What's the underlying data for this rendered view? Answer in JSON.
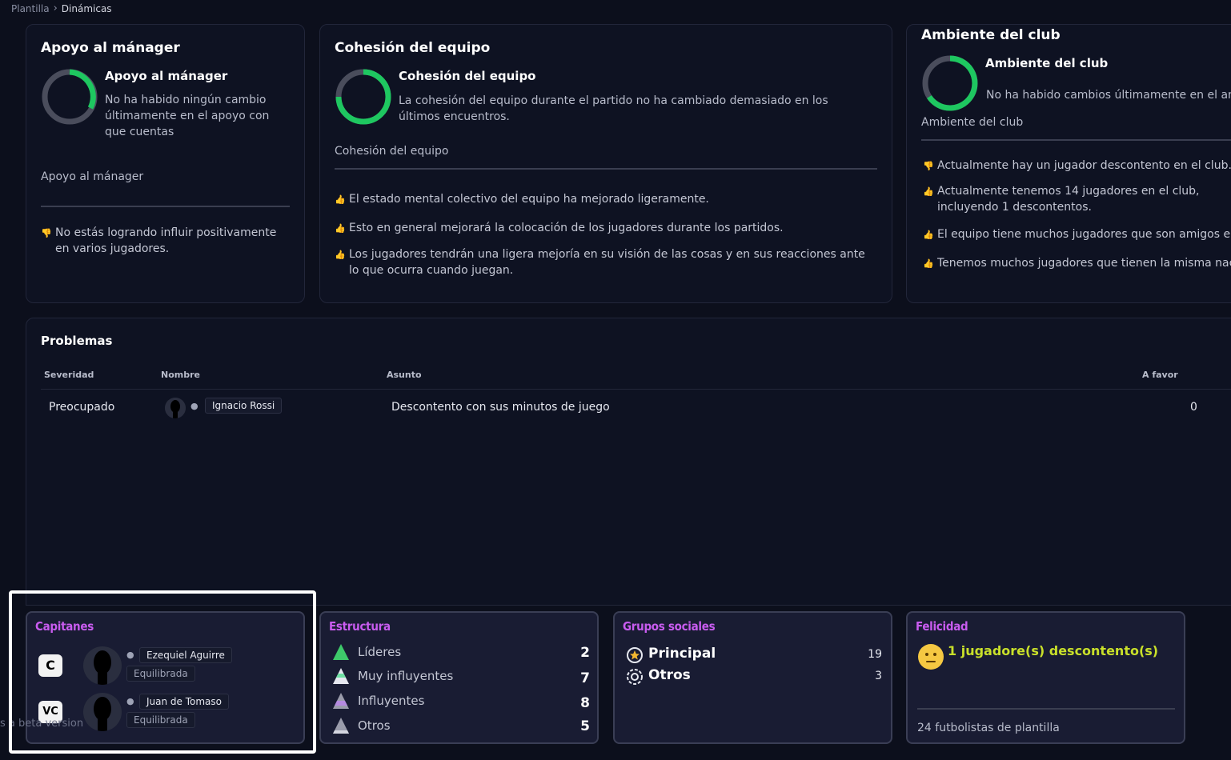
{
  "breadcrumb": {
    "parent": "Plantilla",
    "separator": ">",
    "current": "Dinámicas"
  },
  "manager_card": {
    "title": "Apoyo al mánager",
    "subtitle": "Apoyo al mánager",
    "description": "No ha habido ningún cambio últimamente en el apoyo con que cuentas",
    "caption": "Apoyo al mánager",
    "facts": [
      {
        "text": "No estás logrando influir positivamente en varios jugadores.",
        "icon": "thumbs-down-icon"
      }
    ]
  },
  "cohesion_card": {
    "title": "Cohesión del equipo",
    "subtitle": "Cohesión del equipo",
    "description": "La cohesión del equipo durante el partido no ha cambiado demasiado en los últimos encuentros.",
    "caption": "Cohesión del equipo",
    "facts": [
      {
        "text": "El estado mental colectivo del equipo ha mejorado ligeramente.",
        "icon": "thumbs-up-icon"
      },
      {
        "text": "Esto en general mejorará la colocación de los jugadores durante los partidos.",
        "icon": "thumbs-up-icon"
      },
      {
        "text": "Los jugadores tendrán una ligera mejoría en su visión de las cosas y en sus reacciones ante lo que ocurra cuando juegan.",
        "icon": "thumbs-up-icon"
      }
    ]
  },
  "club_card": {
    "title": "Ambiente del club",
    "subtitle": "Ambiente del club",
    "description": "No ha habido cambios últimamente en el ambiente del club",
    "caption": "Ambiente del club",
    "facts": [
      {
        "text": "Actualmente hay un jugador descontento en el club.",
        "icon": "thumbs-down-icon"
      },
      {
        "text": "Actualmente tenemos 14 jugadores en el club, incluyendo 1 descontentos.",
        "icon": "thumbs-up-icon"
      },
      {
        "text": "El equipo tiene muchos jugadores que son amigos entre sí.",
        "icon": "thumbs-up-icon"
      },
      {
        "text": "Tenemos muchos jugadores que tienen la misma nacionalidad.",
        "icon": "thumbs-up-icon"
      }
    ]
  },
  "problems": {
    "title": "Problemas",
    "headers": {
      "severity": "Severidad",
      "name": "Nombre",
      "subject": "Asunto",
      "favor": "A favor"
    },
    "rows": [
      {
        "severity": "Preocupado",
        "name": "Ignacio Rossi",
        "subject": "Descontento con sus minutos de juego",
        "favor": "0"
      }
    ]
  },
  "captains": {
    "title": "Capitanes",
    "items": [
      {
        "badge": "C",
        "name": "Ezequiel Aguirre",
        "status": "Equilibrada"
      },
      {
        "badge": "VC",
        "name": "Juan de Tomaso",
        "status": "Equilibrada"
      }
    ]
  },
  "structure": {
    "title": "Estructura",
    "rows": [
      {
        "label": "Líderes",
        "value": "2",
        "color": "#3ec96a"
      },
      {
        "label": "Muy influyentes",
        "value": "7",
        "color": "#6fe0a3"
      },
      {
        "label": "Influyentes",
        "value": "8",
        "color": "#b58ae0"
      },
      {
        "label": "Otros",
        "value": "5",
        "color": "#9a9cab"
      }
    ]
  },
  "social": {
    "title": "Grupos sociales",
    "rows": [
      {
        "label": "Principal",
        "value": "19",
        "icon": "star-circle-icon"
      },
      {
        "label": "Otros",
        "value": "3",
        "icon": "ring-circle-icon"
      }
    ]
  },
  "happiness": {
    "title": "Felicidad",
    "status": "1 jugadore(s) descontento(s)",
    "footer": "24 futbolistas de plantilla",
    "accent": "#c9e02a"
  },
  "beta_text": "s a beta version",
  "colors": {
    "accent_green": "#1ec760",
    "title_purple": "#c95cf0",
    "background": "#0c0f1c"
  }
}
